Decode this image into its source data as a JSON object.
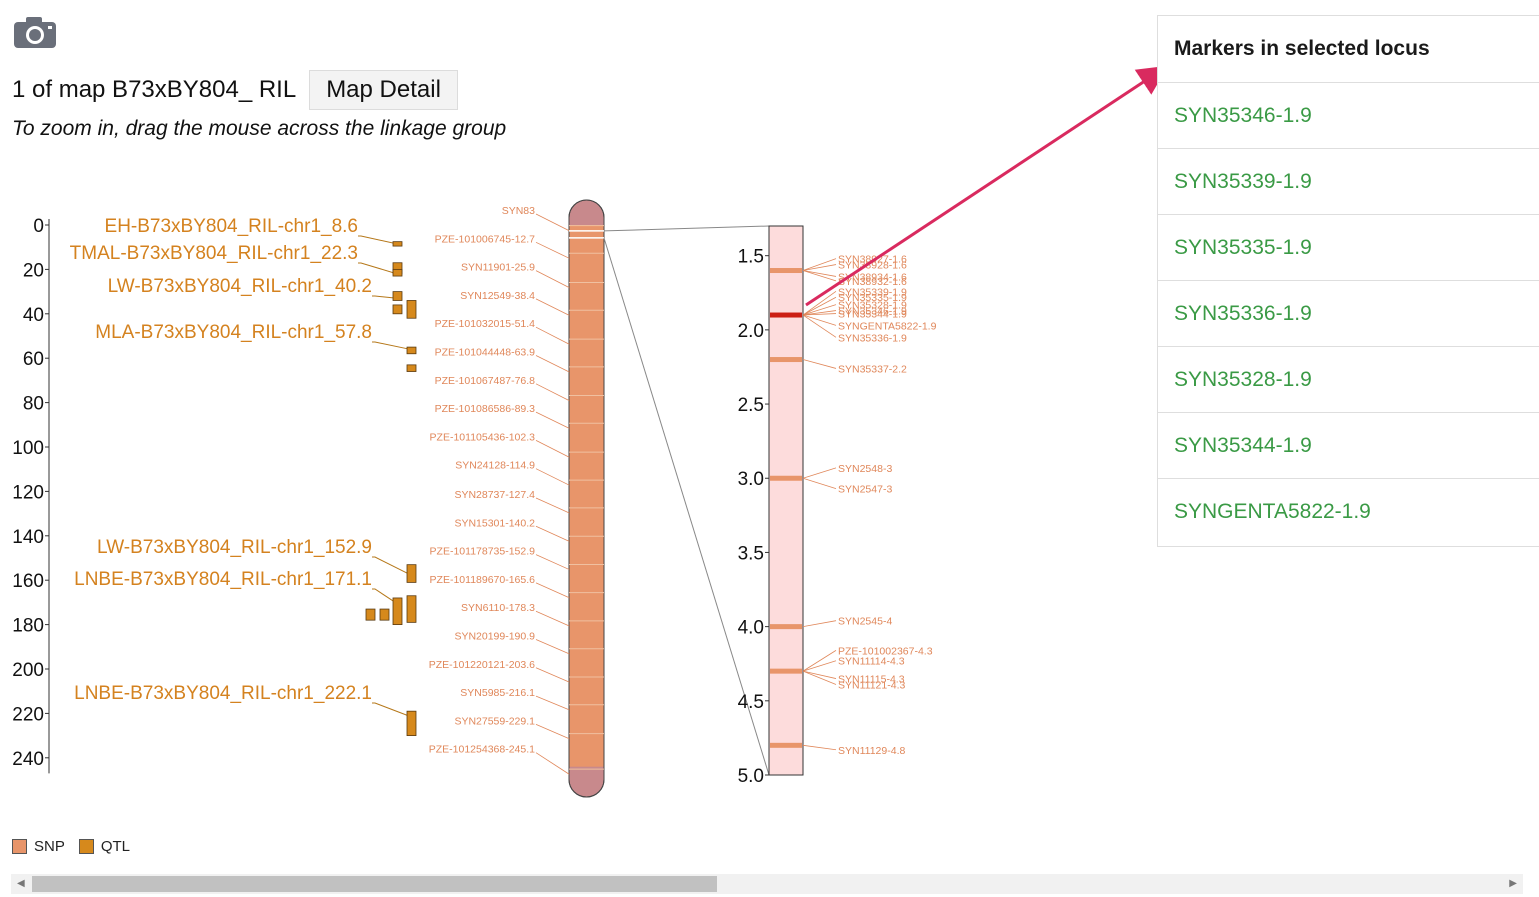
{
  "header": {
    "map_title": "1 of map B73xBY804_ RIL",
    "map_detail_label": "Map Detail",
    "zoom_hint": "To zoom in, drag the mouse across the linkage group"
  },
  "icons": {
    "camera": "camera-icon",
    "scroll_left": "chevron-left-icon",
    "scroll_right": "chevron-right-icon"
  },
  "colors": {
    "snp": "#e8956a",
    "qtl": "#d6891c",
    "qtl_label": "#d4821f",
    "marker_label": "#e0875a",
    "zoom_fill": "#fddcdc",
    "selected": "#cc1f14",
    "arrow": "#d92a5f",
    "marker_link": "#3a9a45"
  },
  "chart_data": [
    {
      "type": "linkage-map-overview",
      "axis_ticks": [
        0,
        20,
        40,
        60,
        80,
        100,
        120,
        140,
        160,
        180,
        200,
        220,
        240
      ],
      "ylim": [
        0,
        248
      ],
      "chromosome_length": 258,
      "qtl_labels": [
        {
          "label": "EH-B73xBY804_RIL-chr1_8.6",
          "pos": 8.6
        },
        {
          "label": "TMAL-B73xBY804_RIL-chr1_22.3",
          "pos": 22.3
        },
        {
          "label": "LW-B73xBY804_RIL-chr1_40.2",
          "pos": 40.2
        },
        {
          "label": "MLA-B73xBY804_RIL-chr1_57.8",
          "pos": 57.8
        },
        {
          "label": "LW-B73xBY804_RIL-chr1_152.9",
          "pos": 152.9
        },
        {
          "label": "LNBE-B73xBY804_RIL-chr1_171.1",
          "pos": 171.1
        },
        {
          "label": "LNBE-B73xBY804_RIL-chr1_222.1",
          "pos": 222.1
        }
      ],
      "qtls": [
        {
          "start": 7.5,
          "end": 9.5,
          "col": 0
        },
        {
          "start": 17,
          "end": 22,
          "col": 0
        },
        {
          "start": 20,
          "end": 23,
          "col": 0
        },
        {
          "start": 30,
          "end": 34,
          "col": 0
        },
        {
          "start": 36,
          "end": 40,
          "col": 0
        },
        {
          "start": 34,
          "end": 42,
          "col": 1
        },
        {
          "start": 55,
          "end": 58,
          "col": 1
        },
        {
          "start": 63,
          "end": 66,
          "col": 1
        },
        {
          "start": 153,
          "end": 161,
          "col": 1
        },
        {
          "start": 167,
          "end": 179,
          "col": 1
        },
        {
          "start": 168,
          "end": 180,
          "col": 2
        },
        {
          "start": 173,
          "end": 178,
          "col": 3
        },
        {
          "start": 173,
          "end": 178,
          "col": 4
        },
        {
          "start": 219,
          "end": 230,
          "col": 1
        }
      ],
      "markers": [
        {
          "label": "SYN83",
          "pos": 0.3
        },
        {
          "label": "PZE-101006745-12.7",
          "pos": 12.7
        },
        {
          "label": "SYN11901-25.9",
          "pos": 25.9
        },
        {
          "label": "SYN12549-38.4",
          "pos": 38.4
        },
        {
          "label": "PZE-101032015-51.4",
          "pos": 51.4
        },
        {
          "label": "PZE-101044448-63.9",
          "pos": 63.9
        },
        {
          "label": "PZE-101067487-76.8",
          "pos": 76.8
        },
        {
          "label": "PZE-101086586-89.3",
          "pos": 89.3
        },
        {
          "label": "PZE-101105436-102.3",
          "pos": 102.3
        },
        {
          "label": "SYN24128-114.9",
          "pos": 114.9
        },
        {
          "label": "SYN28737-127.4",
          "pos": 127.4
        },
        {
          "label": "SYN15301-140.2",
          "pos": 140.2
        },
        {
          "label": "PZE-101178735-152.9",
          "pos": 152.9
        },
        {
          "label": "PZE-101189670-165.6",
          "pos": 165.6
        },
        {
          "label": "SYN6110-178.3",
          "pos": 178.3
        },
        {
          "label": "SYN20199-190.9",
          "pos": 190.9
        },
        {
          "label": "PZE-101220121-203.6",
          "pos": 203.6
        },
        {
          "label": "SYN5985-216.1",
          "pos": 216.1
        },
        {
          "label": "SYN27559-229.1",
          "pos": 229.1
        },
        {
          "label": "PZE-101254368-245.1",
          "pos": 245.1
        }
      ],
      "selection": [
        1.3,
        5.0
      ]
    },
    {
      "type": "linkage-map-zoom",
      "axis_ticks": [
        "1.5",
        "2.0",
        "2.5",
        "3.0",
        "3.5",
        "4.0",
        "4.5",
        "5.0"
      ],
      "ylim": [
        1.3,
        5.0
      ],
      "bands": [
        {
          "pos": 1.6,
          "selected": false
        },
        {
          "pos": 1.9,
          "selected": true
        },
        {
          "pos": 2.2,
          "selected": false
        },
        {
          "pos": 3.0,
          "selected": false
        },
        {
          "pos": 4.0,
          "selected": false
        },
        {
          "pos": 4.3,
          "selected": false
        },
        {
          "pos": 4.8,
          "selected": false
        }
      ],
      "markers": [
        {
          "label": "SYN38927-1.6",
          "pos": 1.6,
          "label_pos": 1.52
        },
        {
          "label": "SYN38928-1.6",
          "pos": 1.6,
          "label_pos": 1.56
        },
        {
          "label": "SYN38934-1.6",
          "pos": 1.6,
          "label_pos": 1.64
        },
        {
          "label": "SYN38932-1.6",
          "pos": 1.6,
          "label_pos": 1.67
        },
        {
          "label": "SYN35339-1.9",
          "pos": 1.9,
          "label_pos": 1.74
        },
        {
          "label": "SYN35335-1.9",
          "pos": 1.9,
          "label_pos": 1.78
        },
        {
          "label": "SYN35328-1.9",
          "pos": 1.9,
          "label_pos": 1.83
        },
        {
          "label": "SYN35346-1.9",
          "pos": 1.9,
          "label_pos": 1.87
        },
        {
          "label": "SYN35344-1.9",
          "pos": 1.9,
          "label_pos": 1.89
        },
        {
          "label": "SYNGENTA5822-1.9",
          "pos": 1.9,
          "label_pos": 1.97
        },
        {
          "label": "SYN35336-1.9",
          "pos": 1.9,
          "label_pos": 2.05
        },
        {
          "label": "SYN35337-2.2",
          "pos": 2.2,
          "label_pos": 2.26
        },
        {
          "label": "SYN2548-3",
          "pos": 3.0,
          "label_pos": 2.93
        },
        {
          "label": "SYN2547-3",
          "pos": 3.0,
          "label_pos": 3.07
        },
        {
          "label": "SYN2545-4",
          "pos": 4.0,
          "label_pos": 3.96
        },
        {
          "label": "PZE-101002367-4.3",
          "pos": 4.3,
          "label_pos": 4.16
        },
        {
          "label": "SYN11114-4.3",
          "pos": 4.3,
          "label_pos": 4.23
        },
        {
          "label": "SYN11115-4.3",
          "pos": 4.3,
          "label_pos": 4.35
        },
        {
          "label": "SYN11121-4.3",
          "pos": 4.3,
          "label_pos": 4.39
        },
        {
          "label": "SYN11129-4.8",
          "pos": 4.8,
          "label_pos": 4.83
        }
      ]
    }
  ],
  "legend": [
    {
      "label": "SNP",
      "color": "#e8956a"
    },
    {
      "label": "QTL",
      "color": "#d6891c"
    }
  ],
  "panel": {
    "title": "Markers in selected locus",
    "items": [
      "SYN35346-1.9",
      "SYN35339-1.9",
      "SYN35335-1.9",
      "SYN35336-1.9",
      "SYN35328-1.9",
      "SYN35344-1.9",
      "SYNGENTA5822-1.9"
    ]
  }
}
